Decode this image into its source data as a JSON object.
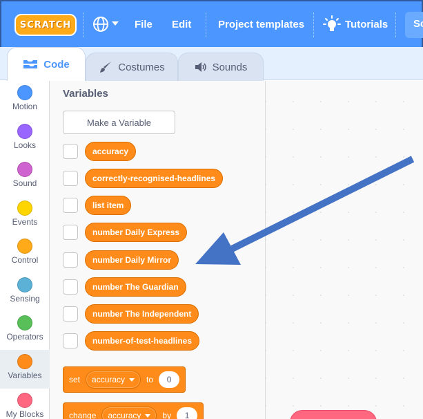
{
  "menubar": {
    "logo_text": "SCRATCH",
    "file_label": "File",
    "edit_label": "Edit",
    "templates_label": "Project templates",
    "tutorials_label": "Tutorials",
    "search_partial": "Sc",
    "globe_icon": "globe-icon",
    "bulb_icon": "lightbulb-icon"
  },
  "tabs": [
    {
      "label": "Code",
      "icon": "code-icon",
      "active": true
    },
    {
      "label": "Costumes",
      "icon": "brush-icon",
      "active": false
    },
    {
      "label": "Sounds",
      "icon": "speaker-icon",
      "active": false
    }
  ],
  "categories": [
    {
      "label": "Motion",
      "color": "#4c97ff"
    },
    {
      "label": "Looks",
      "color": "#9966ff"
    },
    {
      "label": "Sound",
      "color": "#cf63cf"
    },
    {
      "label": "Events",
      "color": "#ffd500"
    },
    {
      "label": "Control",
      "color": "#ffab19"
    },
    {
      "label": "Sensing",
      "color": "#5cb1d6"
    },
    {
      "label": "Operators",
      "color": "#59c059"
    },
    {
      "label": "Variables",
      "color": "#ff8c1a",
      "selected": true
    },
    {
      "label": "My Blocks",
      "color": "#ff6680"
    }
  ],
  "palette": {
    "title": "Variables",
    "make_variable_label": "Make a Variable",
    "variables": [
      "accuracy",
      "correctly-recognised-headlines",
      "list item",
      "number Daily Express",
      "number Daily Mirror",
      "number The Guardian",
      "number The Independent",
      "number-of-test-headlines"
    ],
    "set_block": {
      "verb": "set",
      "variable": "accuracy",
      "connector": "to",
      "value": "0"
    },
    "change_block": {
      "verb": "change",
      "variable": "accuracy",
      "connector": "by",
      "value": "1"
    }
  },
  "colors": {
    "menubar": "#4c97ff",
    "variables": "#ff8c1a",
    "annotation_arrow": "#4472c4"
  }
}
